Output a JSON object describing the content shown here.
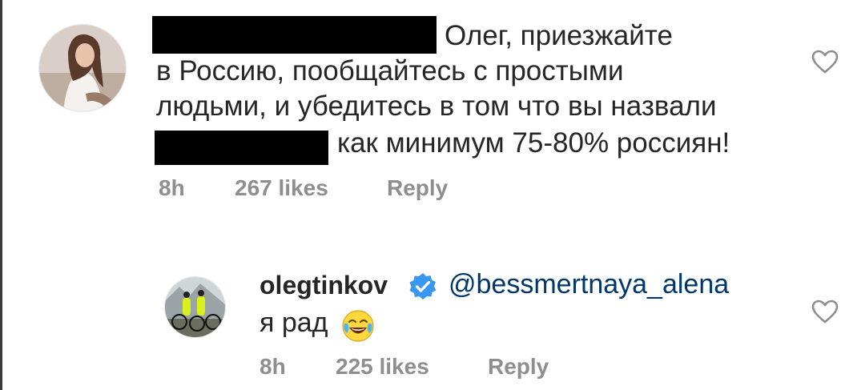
{
  "comment_1": {
    "text_lines": [
      "Олег, приезжайте",
      "в Россию, пообщайтесь с простыми",
      "людьми, и убедитесь в том что вы назвали",
      "как минимум 75-80% россиян!"
    ],
    "time": "8h",
    "likes": "267 likes",
    "reply_label": "Reply",
    "like_icon": "heart-outline-icon"
  },
  "comment_2": {
    "username": "olegtinkov",
    "verified_icon": "verified-badge-icon",
    "mention": "@bessmertnaya_alena",
    "text": "я рад",
    "emoji": "face-with-tears-of-joy",
    "time": "8h",
    "likes": "225 likes",
    "reply_label": "Reply",
    "like_icon": "heart-outline-icon"
  },
  "colors": {
    "text": "#262626",
    "secondary": "#8e8e8e",
    "link": "#00376b",
    "verified": "#3897f0",
    "redaction": "#000000"
  }
}
